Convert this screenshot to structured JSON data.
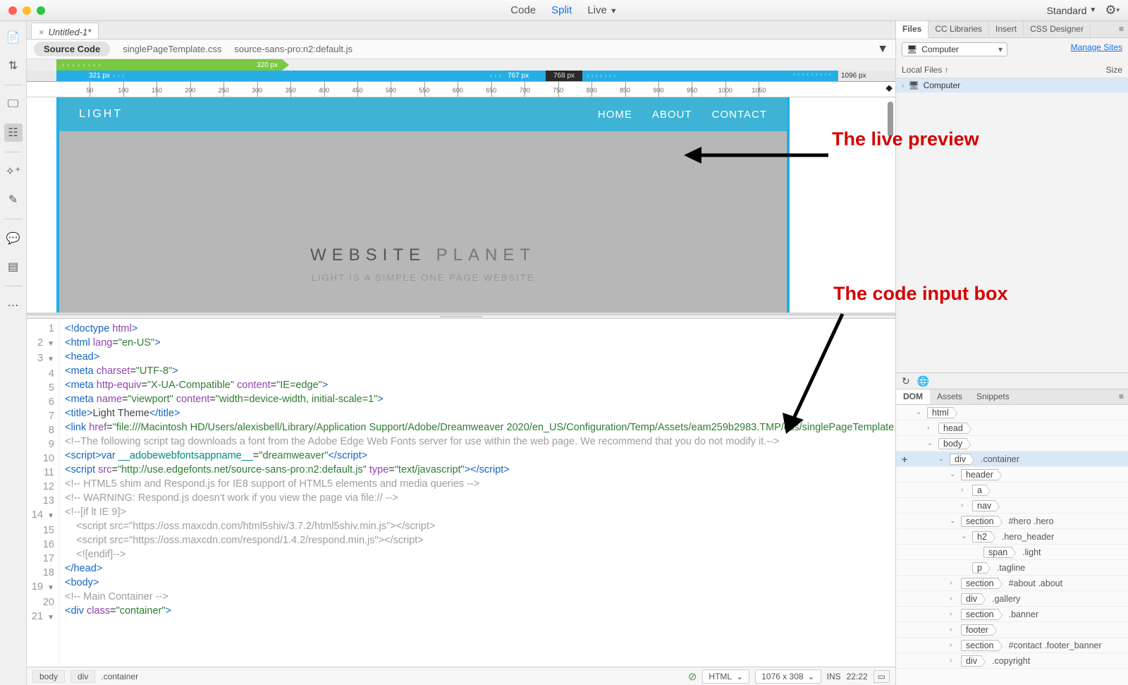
{
  "titlebar": {
    "view_tabs": [
      "Code",
      "Split",
      "Live"
    ],
    "active_view": "Split",
    "workspace": "Standard"
  },
  "document": {
    "tab_title": "Untitled-1*",
    "source_pill": "Source Code",
    "related": [
      "singlePageTemplate.css",
      "source-sans-pro:n2:default.js"
    ]
  },
  "media_queries": {
    "green": "320  px",
    "blue_left": "321  px",
    "blue_right": "767  px",
    "dark": "768  px",
    "end": "1096  px"
  },
  "ruler_labels": [
    "50",
    "100",
    "150",
    "200",
    "250",
    "300",
    "350",
    "400",
    "450",
    "500",
    "550",
    "600",
    "650",
    "700",
    "750",
    "800",
    "850",
    "900",
    "950",
    "1000",
    "1050"
  ],
  "preview": {
    "logo": "LIGHT",
    "nav": [
      "HOME",
      "ABOUT",
      "CONTACT"
    ],
    "hero_dark": "WEBSITE",
    "hero_light": "PLANET",
    "tagline": "LIGHT IS A SIMPLE ONE PAGE WEBSITE"
  },
  "code_lines": [
    {
      "n": 1,
      "f": "",
      "html": "<span class='c-tag'>&lt;!doctype</span> <span class='c-attr'>html</span><span class='c-tag'>&gt;</span>"
    },
    {
      "n": 2,
      "f": "▼",
      "html": "<span class='c-tag'>&lt;html</span> <span class='c-attr'>lang</span>=<span class='c-str'>\"en-US\"</span><span class='c-tag'>&gt;</span>"
    },
    {
      "n": 3,
      "f": "▼",
      "html": "<span class='c-tag'>&lt;head&gt;</span>"
    },
    {
      "n": 4,
      "f": "",
      "html": "<span class='c-tag'>&lt;meta</span> <span class='c-attr'>charset</span>=<span class='c-str'>\"UTF-8\"</span><span class='c-tag'>&gt;</span>"
    },
    {
      "n": 5,
      "f": "",
      "html": "<span class='c-tag'>&lt;meta</span> <span class='c-attr'>http-equiv</span>=<span class='c-str'>\"X-UA-Compatible\"</span> <span class='c-attr'>content</span>=<span class='c-str'>\"IE=edge\"</span><span class='c-tag'>&gt;</span>"
    },
    {
      "n": 6,
      "f": "",
      "html": "<span class='c-tag'>&lt;meta</span> <span class='c-attr'>name</span>=<span class='c-str'>\"viewport\"</span> <span class='c-attr'>content</span>=<span class='c-str'>\"width=device-width, initial-scale=1\"</span><span class='c-tag'>&gt;</span>"
    },
    {
      "n": 7,
      "f": "",
      "html": "<span class='c-tag'>&lt;title&gt;</span><span class='c-txt'>Light Theme</span><span class='c-tag'>&lt;/title&gt;</span>"
    },
    {
      "n": 8,
      "f": "",
      "html": "<span class='c-tag'>&lt;link</span> <span class='c-attr'>href</span>=<span class='c-str'>\"file:///Macintosh HD/Users/alexisbell/Library/Application Support/Adobe/Dreamweaver 2020/en_US/Configuration/Temp/Assets/eam259b2983.TMP/css/singlePageTemplate.css\"</span> <span class='c-attr'>rel</span>=<span class='c-str'>\"stylesheet\"</span> <span class='c-attr'>type</span>=<span class='c-str'>\"text/css\"</span><span class='c-tag'>&gt;</span>"
    },
    {
      "n": 9,
      "f": "",
      "html": "<span class='c-com'>&lt;!--The following script tag downloads a font from the Adobe Edge Web Fonts server for use within the web page. We recommend that you do not modify it.--&gt;</span>"
    },
    {
      "n": 10,
      "f": "",
      "html": "<span class='c-tag'>&lt;script&gt;</span><span class='c-kwd'>var</span> <span class='c-fn'>__adobewebfontsappname__</span>=<span class='c-str'>\"dreamweaver\"</span><span class='c-tag'>&lt;/script&gt;</span>"
    },
    {
      "n": 11,
      "f": "",
      "html": "<span class='c-tag'>&lt;script</span> <span class='c-attr'>src</span>=<span class='c-str'>\"http://use.edgefonts.net/source-sans-pro:n2:default.js\"</span> <span class='c-attr'>type</span>=<span class='c-str'>\"text/javascript\"</span><span class='c-tag'>&gt;&lt;/script&gt;</span>"
    },
    {
      "n": 12,
      "f": "",
      "html": "<span class='c-com'>&lt;!-- HTML5 shim and Respond.js for IE8 support of HTML5 elements and media queries --&gt;</span>"
    },
    {
      "n": 13,
      "f": "",
      "html": "<span class='c-com'>&lt;!-- WARNING: Respond.js doesn't work if you view the page via file:// --&gt;</span>"
    },
    {
      "n": 14,
      "f": "▼",
      "html": "<span class='c-com'>&lt;!--[if lt IE 9]&gt;</span>"
    },
    {
      "n": 15,
      "f": "",
      "html": "<span class='c-com'>    &lt;script src=\"https://oss.maxcdn.com/html5shiv/3.7.2/html5shiv.min.js\"&gt;&lt;/script&gt;</span>"
    },
    {
      "n": 16,
      "f": "",
      "html": "<span class='c-com'>    &lt;script src=\"https://oss.maxcdn.com/respond/1.4.2/respond.min.js\"&gt;&lt;/script&gt;</span>"
    },
    {
      "n": 17,
      "f": "",
      "html": "<span class='c-com'>    &lt;![endif]--&gt;</span>"
    },
    {
      "n": 18,
      "f": "",
      "html": "<span class='c-tag'>&lt;/head&gt;</span>"
    },
    {
      "n": 19,
      "f": "▼",
      "html": "<span class='c-tag'>&lt;body&gt;</span>"
    },
    {
      "n": 20,
      "f": "",
      "html": "<span class='c-com'>&lt;!-- Main Container --&gt;</span>"
    },
    {
      "n": 21,
      "f": "▼",
      "html": "<span class='c-tag'>&lt;div</span> <span class='c-attr'>class</span>=<span class='c-str'>\"container\"</span><span class='c-tag'>&gt;</span>"
    }
  ],
  "status": {
    "crumbs": [
      "body",
      "div",
      ".container"
    ],
    "lang": "HTML",
    "size": "1076 x 308",
    "ins": "INS",
    "pos": "22:22"
  },
  "right_panels": {
    "files_tabs": [
      "Files",
      "CC Libraries",
      "Insert",
      "CSS Designer"
    ],
    "active_files_tab": "Files",
    "dropdown": "Computer",
    "manage": "Manage Sites",
    "col1": "Local Files ↑",
    "col2": "Size",
    "root": "Computer",
    "dom_tabs": [
      "DOM",
      "Assets",
      "Snippets"
    ],
    "active_dom_tab": "DOM"
  },
  "dom_tree": [
    {
      "depth": 0,
      "tri": "⌄",
      "tag": "html",
      "sel": ""
    },
    {
      "depth": 1,
      "tri": "›",
      "tag": "head",
      "sel": ""
    },
    {
      "depth": 1,
      "tri": "⌄",
      "tag": "body",
      "sel": ""
    },
    {
      "depth": 2,
      "tri": "⌄",
      "tag": "div",
      "sel": ".container",
      "selected": true,
      "add": true
    },
    {
      "depth": 3,
      "tri": "⌄",
      "tag": "header",
      "sel": ""
    },
    {
      "depth": 4,
      "tri": "›",
      "tag": "a",
      "sel": ""
    },
    {
      "depth": 4,
      "tri": "›",
      "tag": "nav",
      "sel": ""
    },
    {
      "depth": 3,
      "tri": "⌄",
      "tag": "section",
      "sel": "#hero .hero"
    },
    {
      "depth": 4,
      "tri": "⌄",
      "tag": "h2",
      "sel": ".hero_header"
    },
    {
      "depth": 5,
      "tri": "",
      "tag": "span",
      "sel": ".light"
    },
    {
      "depth": 4,
      "tri": "",
      "tag": "p",
      "sel": ".tagline"
    },
    {
      "depth": 3,
      "tri": "›",
      "tag": "section",
      "sel": "#about .about"
    },
    {
      "depth": 3,
      "tri": "›",
      "tag": "div",
      "sel": ".gallery"
    },
    {
      "depth": 3,
      "tri": "›",
      "tag": "section",
      "sel": ".banner"
    },
    {
      "depth": 3,
      "tri": "›",
      "tag": "footer",
      "sel": ""
    },
    {
      "depth": 3,
      "tri": "›",
      "tag": "section",
      "sel": "#contact .footer_banner"
    },
    {
      "depth": 3,
      "tri": "›",
      "tag": "div",
      "sel": ".copyright"
    }
  ],
  "annotations": {
    "a1": "The live preview",
    "a2": "The code input box"
  }
}
